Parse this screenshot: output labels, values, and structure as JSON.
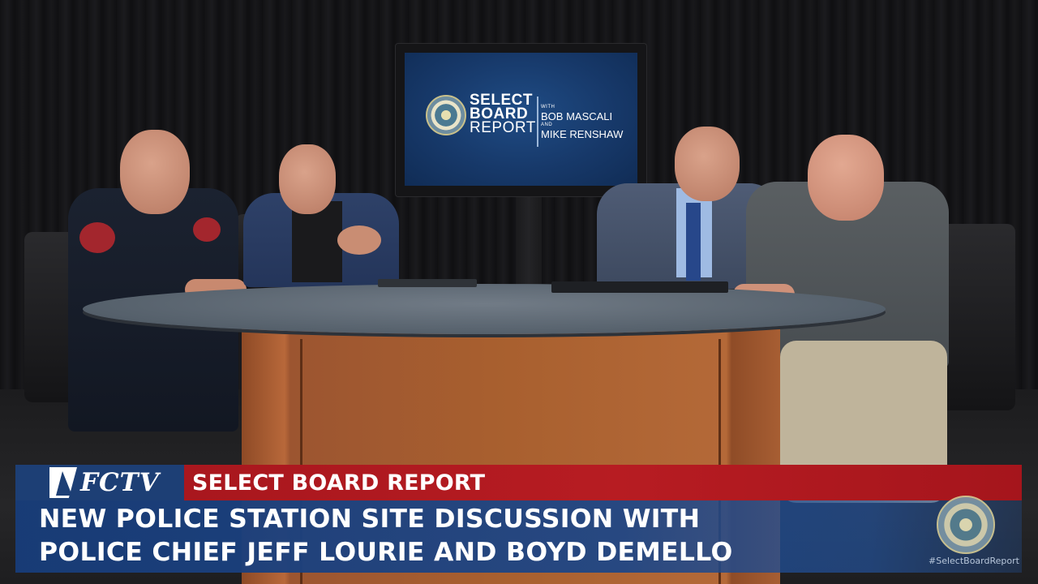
{
  "monitor": {
    "line1": "SELECT",
    "line2": "BOARD",
    "line3": "REPORT",
    "with_label": "WITH",
    "host1": "BOB MASCALI",
    "and_label": "AND",
    "host2": "MIKE RENSHAW"
  },
  "lower_third": {
    "logo": "FCTV",
    "segment_title": "SELECT BOARD REPORT",
    "headline_line1": "NEW POLICE STATION SITE DISCUSSION WITH",
    "headline_line2": "POLICE CHIEF JEFF LOURIE AND BOYD DEMELLO",
    "hashtag": "#SelectBoardReport"
  },
  "colors": {
    "red_band": "#b71c22",
    "blue_band": "#1d4687",
    "logo_box": "#1d3f75"
  }
}
